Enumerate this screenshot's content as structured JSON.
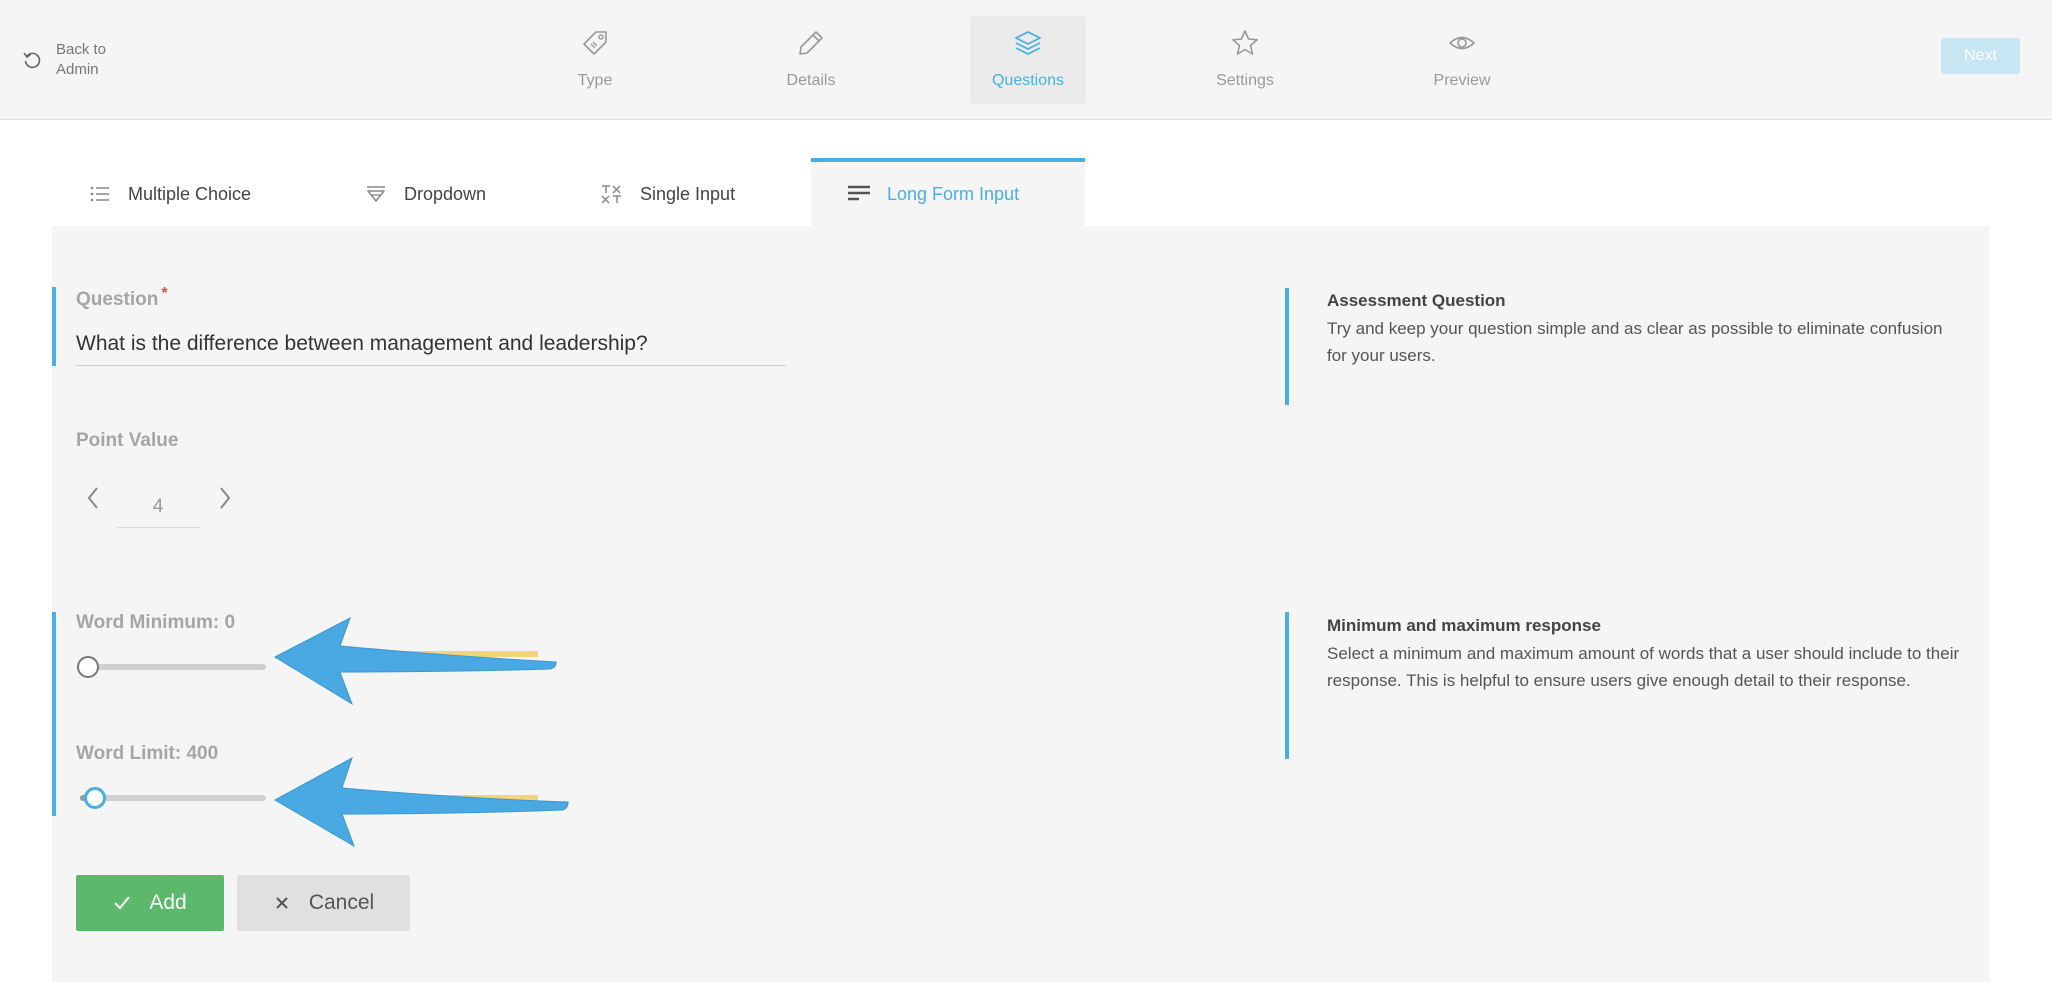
{
  "header": {
    "back_label": "Back to Admin",
    "steps": [
      {
        "label": "Type",
        "icon": "tag-icon"
      },
      {
        "label": "Details",
        "icon": "pencil-icon"
      },
      {
        "label": "Questions",
        "icon": "layers-icon",
        "active": true
      },
      {
        "label": "Settings",
        "icon": "star-icon"
      },
      {
        "label": "Preview",
        "icon": "eye-icon"
      }
    ],
    "next_label": "Next"
  },
  "tabs": [
    {
      "label": "Multiple Choice",
      "icon": "list-icon"
    },
    {
      "label": "Dropdown",
      "icon": "dropdown-icon"
    },
    {
      "label": "Single Input",
      "icon": "text-input-icon"
    },
    {
      "label": "Long Form Input",
      "icon": "paragraph-icon",
      "active": true
    }
  ],
  "form": {
    "question_label": "Question",
    "required_mark": "*",
    "question_value": "What is the difference between management and leadership?",
    "point_value_label": "Point Value",
    "point_value": "4",
    "word_minimum_label": "Word Minimum: 0",
    "word_minimum_fraction": 0.0,
    "word_limit_label": "Word Limit: 400",
    "word_limit_fraction": 0.08,
    "add_label": "Add",
    "cancel_label": "Cancel"
  },
  "help": {
    "assessment_title": "Assessment Question",
    "assessment_text": "Try and keep your question simple and as clear as possible to eliminate confusion for your users.",
    "minmax_title": "Minimum and maximum response",
    "minmax_text": "Select a minimum and maximum amount of words that a user should include to their response. This is helpful to ensure users give enough detail to their response."
  },
  "colors": {
    "accent": "#45b0e1",
    "add_green": "#5cb96b",
    "annotation_arrow": "#4aa9e3",
    "annotation_highlight": "#f2d675"
  }
}
